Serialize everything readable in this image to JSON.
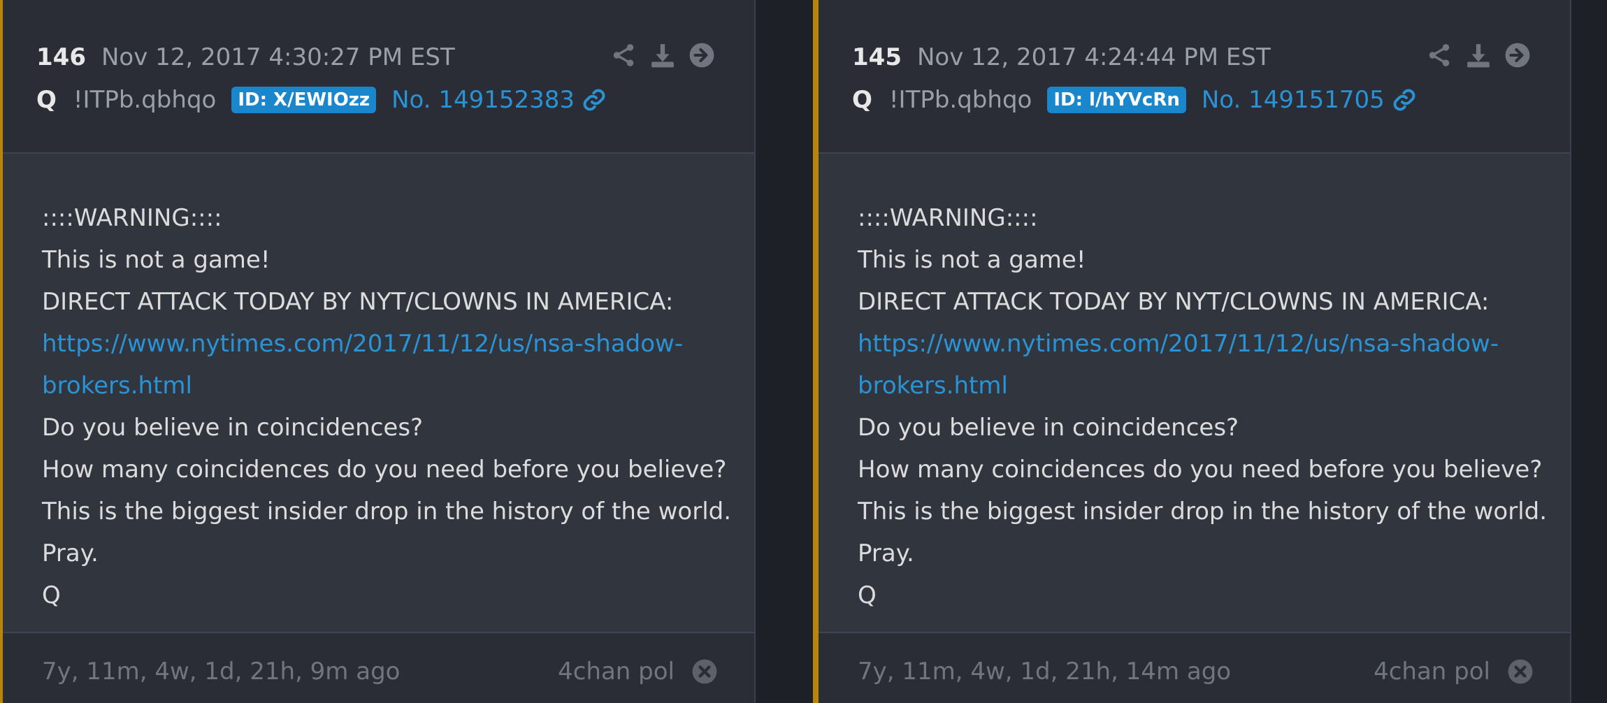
{
  "colors": {
    "accent_border": "#b8860b",
    "link": "#2a93d5",
    "id_badge": "#1a86cc",
    "background": "#1d2027"
  },
  "posts": [
    {
      "number": "146",
      "date": "Nov 12, 2017 4:30:27 PM EST",
      "author": "Q",
      "tripcode": "!ITPb.qbhqo",
      "id_badge": "ID: X/EWIOzz",
      "post_no": "No. 149152383",
      "lines": {
        "l1": "::::WARNING::::",
        "l2": "This is not a game!",
        "l3": "DIRECT ATTACK TODAY BY NYT/CLOWNS IN AMERICA:",
        "link1": "https://www.nytimes.com/2017/11/12/us/nsa-shadow-",
        "link2": "brokers.html",
        "l4": "Do you believe in coincidences?",
        "l5": "How many coincidences do you need before you believe?",
        "l6": "This is the biggest insider drop in the history of the world.",
        "l7": "Pray.",
        "l8": "Q"
      },
      "ago": "7y, 11m, 4w, 1d, 21h, 9m ago",
      "source": "4chan pol",
      "icons": [
        "share-icon",
        "download-icon",
        "arrow-right-icon",
        "link-icon",
        "close-circle-icon"
      ]
    },
    {
      "number": "145",
      "date": "Nov 12, 2017 4:24:44 PM EST",
      "author": "Q",
      "tripcode": "!ITPb.qbhqo",
      "id_badge": "ID: l/hYVcRn",
      "post_no": "No. 149151705",
      "lines": {
        "l1": "::::WARNING::::",
        "l2": "This is not a game!",
        "l3": "DIRECT ATTACK TODAY BY NYT/CLOWNS IN AMERICA:",
        "link1": "https://www.nytimes.com/2017/11/12/us/nsa-shadow-",
        "link2": "brokers.html",
        "l4": "Do you believe in coincidences?",
        "l5": "How many coincidences do you need before you believe?",
        "l6": "This is the biggest insider drop in the history of the world.",
        "l7": "Pray.",
        "l8": "Q"
      },
      "ago": "7y, 11m, 4w, 1d, 21h, 14m ago",
      "source": "4chan pol",
      "icons": [
        "share-icon",
        "download-icon",
        "arrow-right-icon",
        "link-icon",
        "close-circle-icon"
      ]
    }
  ]
}
